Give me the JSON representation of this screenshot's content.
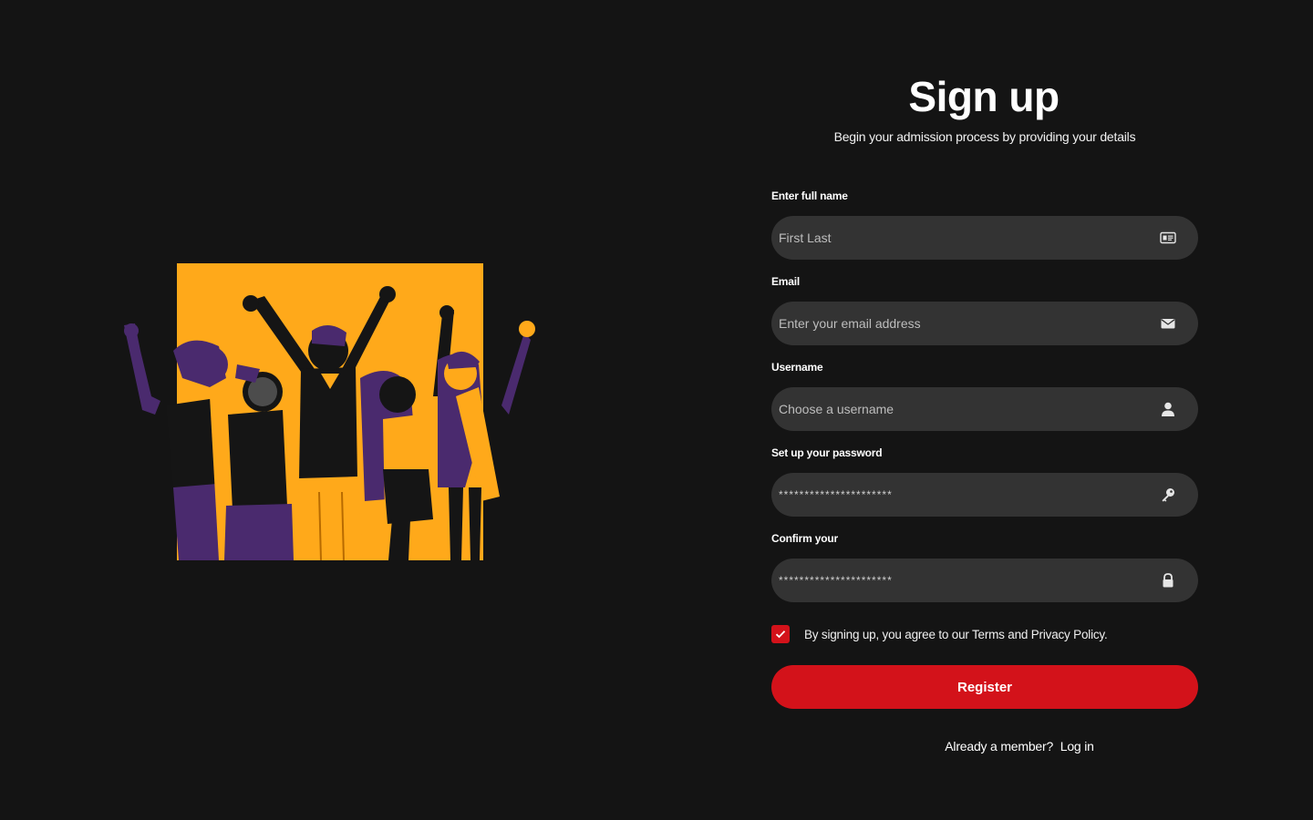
{
  "header": {
    "title": "Sign up",
    "subtitle": "Begin your admission process by providing your details"
  },
  "illustration": {
    "icon": "celebrating-graduates-illustration",
    "colors": {
      "background": "#ffa91a",
      "purple": "#4a2a6e",
      "black": "#151515"
    }
  },
  "form": {
    "full_name": {
      "label": "Enter full name",
      "placeholder": "First Last",
      "icon": "id-card-icon"
    },
    "email": {
      "label": "Email",
      "placeholder": "Enter your email address",
      "icon": "envelope-icon"
    },
    "username": {
      "label": "Username",
      "placeholder": "Choose a username",
      "icon": "user-icon"
    },
    "password": {
      "label": "Set up your password",
      "value": "**********************",
      "icon": "key-icon"
    },
    "confirm": {
      "label": "Confirm your",
      "value": "**********************",
      "icon": "lock-icon"
    },
    "terms": {
      "checked": true,
      "text": "By signing up, you agree to our Terms and Privacy Policy."
    },
    "register_label": "Register"
  },
  "footer": {
    "prompt": "Already a member?",
    "login_link": "Log in"
  },
  "colors": {
    "background": "#141414",
    "input": "#333333",
    "accent": "#d3121a",
    "text": "#ffffff"
  }
}
